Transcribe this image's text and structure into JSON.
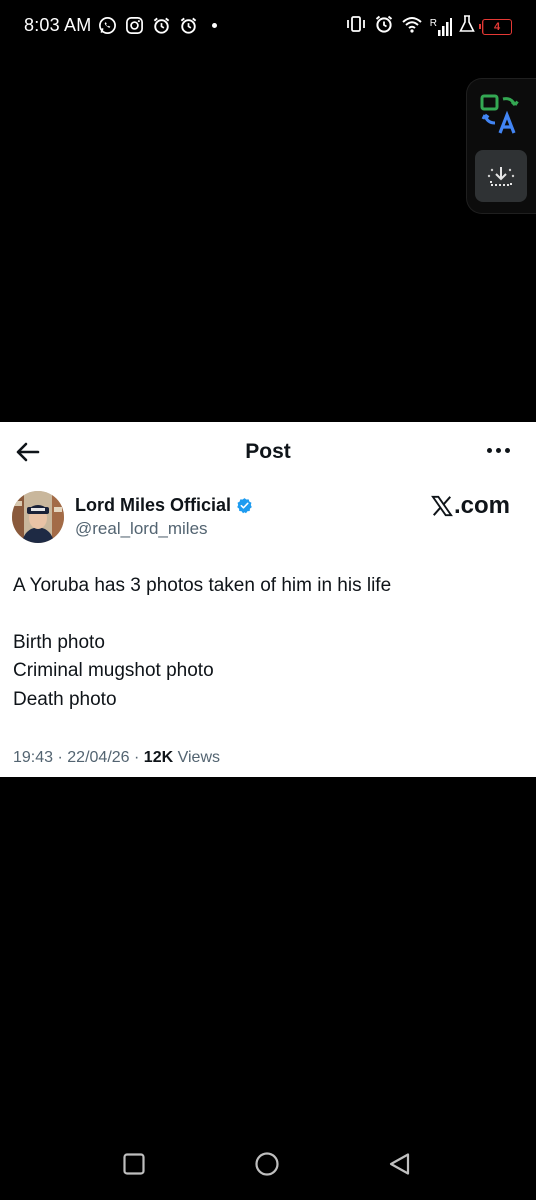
{
  "status_bar": {
    "time": "8:03 AM",
    "left_icons": [
      "whatsapp-icon",
      "instagram-icon",
      "alarm-clock-icon",
      "alarm-clock-icon"
    ],
    "right_icons": [
      "vibrate-icon",
      "alarm-icon",
      "wifi-icon",
      "signal-icon",
      "flask-icon"
    ],
    "signal_label": "R",
    "battery_level": "4",
    "battery_color": "#e53935"
  },
  "floating_widget": {
    "translate_icon": "translate-icon",
    "download_icon": "download-icon"
  },
  "post": {
    "header_title": "Post",
    "back_icon": "back-arrow-icon",
    "more_icon": "more-horizontal-icon",
    "author_name": "Lord Miles Official",
    "author_handle": "@real_lord_miles",
    "verified_color": "#1d9bf0",
    "brand_label": ".com",
    "body_first_line": "A Yoruba has 3 photos taken of him in his life",
    "body_list": [
      "Birth photo",
      "Criminal mugshot photo",
      "Death photo"
    ],
    "meta_time": "19:43",
    "meta_sep": "·",
    "meta_date": "22/04/26",
    "meta_views_count": "12K",
    "meta_views_label": "Views"
  },
  "nav_bar": {
    "recents_icon": "square-icon",
    "home_icon": "circle-icon",
    "back_icon": "triangle-back-icon"
  }
}
